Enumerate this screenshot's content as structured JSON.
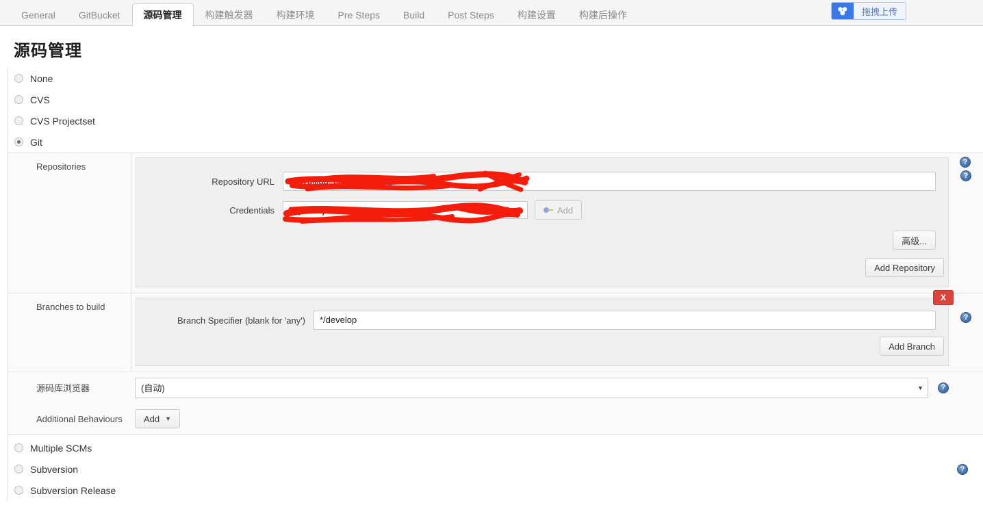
{
  "tabs": [
    {
      "label": "General",
      "active": false
    },
    {
      "label": "GitBucket",
      "active": false
    },
    {
      "label": "源码管理",
      "active": true
    },
    {
      "label": "构建触发器",
      "active": false
    },
    {
      "label": "构建环境",
      "active": false
    },
    {
      "label": "Pre Steps",
      "active": false
    },
    {
      "label": "Build",
      "active": false
    },
    {
      "label": "Post Steps",
      "active": false
    },
    {
      "label": "构建设置",
      "active": false
    },
    {
      "label": "构建后操作",
      "active": false
    }
  ],
  "upload_widget": {
    "label": "拖拽上传",
    "icon": "baidu-cloud-icon",
    "icon_bg": "#3b78e7",
    "border_color": "#a8c3ef"
  },
  "page_title": "源码管理",
  "scm_options": [
    {
      "label": "None",
      "checked": false
    },
    {
      "label": "CVS",
      "checked": false
    },
    {
      "label": "CVS Projectset",
      "checked": false
    },
    {
      "label": "Git",
      "checked": true
    }
  ],
  "scm_options_bottom": [
    {
      "label": "Multiple SCMs",
      "checked": false
    },
    {
      "label": "Subversion",
      "checked": false
    },
    {
      "label": "Subversion Release",
      "checked": false
    }
  ],
  "git": {
    "repositories": {
      "section_label": "Repositories",
      "repository_url": {
        "label": "Repository URL",
        "value": "git@gitlab.                                     chat_we      vice.git",
        "redacted": true
      },
      "credentials": {
        "label": "Credentials",
        "value": "                                           key - as jenkins)",
        "redacted": true,
        "add_button": "Add",
        "add_button_disabled": true
      },
      "advanced_button": "高级...",
      "add_repository_button": "Add Repository"
    },
    "branches": {
      "section_label": "Branches to build",
      "branch_specifier": {
        "label": "Branch Specifier (blank for 'any')",
        "value": "*/develop"
      },
      "delete_badge": "X",
      "add_branch_button": "Add Branch"
    },
    "repo_browser": {
      "label": "源码库浏览器",
      "value": "(自动)"
    },
    "additional_behaviours": {
      "label": "Additional Behaviours",
      "add_button": "Add"
    }
  },
  "help_icon_glyph": "?",
  "colors": {
    "accent_red": "#d9453d",
    "help_blue": "#3d6ca5",
    "panel_bg": "#efefef",
    "section_bg": "#fafafa",
    "upload_blue": "#3b78e7"
  }
}
